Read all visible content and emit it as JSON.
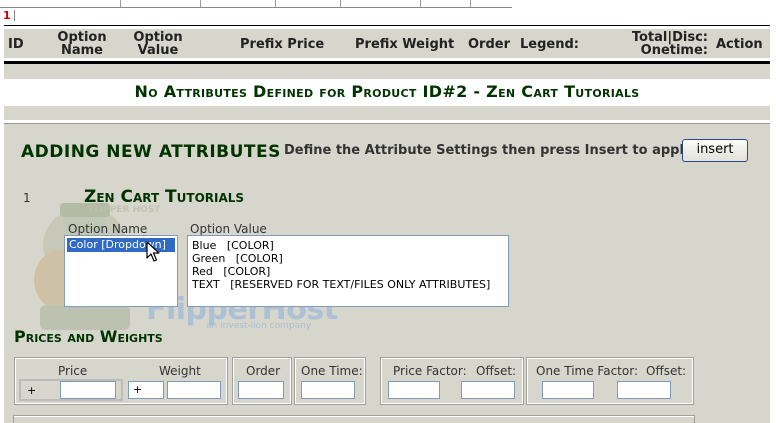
{
  "pagination": {
    "current_page": "1"
  },
  "table_header": {
    "id": "ID",
    "option_name": [
      "Option",
      "Name"
    ],
    "option_value": [
      "Option",
      "Value"
    ],
    "prefix_price": "Prefix Price",
    "prefix_weight": "Prefix Weight",
    "order": "Order",
    "legend": "Legend:",
    "total_disc": [
      "Total|Disc:",
      "Onetime:"
    ],
    "action": "Action"
  },
  "no_attributes_message": "No Attributes Defined for Product ID#2 - Zen Cart Tutorials",
  "add_section": {
    "title": "ADDING NEW ATTRIBUTES",
    "instruction": "Define the Attribute Settings then press Insert to apply",
    "insert_button": "insert"
  },
  "product": {
    "row_number": "1",
    "name": "Zen Cart Tutorials"
  },
  "option_name": {
    "label": "Option Name",
    "selected": "Color  [Dropdown]"
  },
  "option_value": {
    "label": "Option Value",
    "items": [
      "Blue   [COLOR]",
      "Green   [COLOR]",
      "Red   [COLOR]",
      "TEXT   [RESERVED FOR TEXT/FILES ONLY ATTRIBUTES]"
    ]
  },
  "prices_weights": {
    "title": "Prices and Weights",
    "price_label": "Price",
    "price_prefix": "+",
    "weight_label": "Weight",
    "weight_prefix": "+",
    "order_label": "Order",
    "one_time_label": "One Time:",
    "price_factor_label": "Price Factor:",
    "offset_label": "Offset:",
    "one_time_factor_label": "One Time Factor:",
    "offset2_label": "Offset:"
  },
  "watermark": {
    "brand": "FlipperHost",
    "tagline": "an invest-lion company",
    "badge": "FLIPPER HOST"
  },
  "colors": {
    "panel_bg": "#d6d6cc",
    "heading_green": "#003300",
    "selection_blue": "#316ac5",
    "pagination_red": "#cc0000"
  }
}
